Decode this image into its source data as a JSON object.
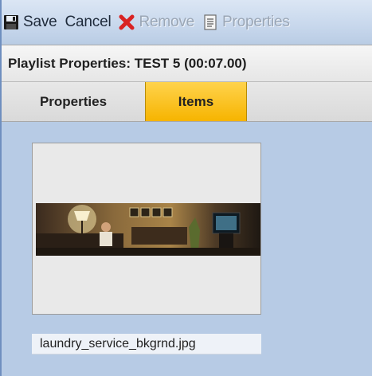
{
  "toolbar": {
    "save_label": "Save",
    "cancel_label": "Cancel",
    "remove_label": "Remove",
    "properties_label": "Properties",
    "icons": {
      "save": "floppy-disk-icon",
      "remove": "red-x-icon",
      "properties": "document-icon"
    }
  },
  "header": {
    "title": "Playlist Properties: TEST 5 (00:07.00)"
  },
  "tabs": [
    {
      "label": "Properties",
      "active": false
    },
    {
      "label": "Items",
      "active": true
    }
  ],
  "items": [
    {
      "filename": "laundry_service_bkgrnd.jpg"
    }
  ],
  "colors": {
    "background": "#b7cbe5",
    "active_tab": "#f6b400",
    "remove_icon": "#d92323"
  }
}
